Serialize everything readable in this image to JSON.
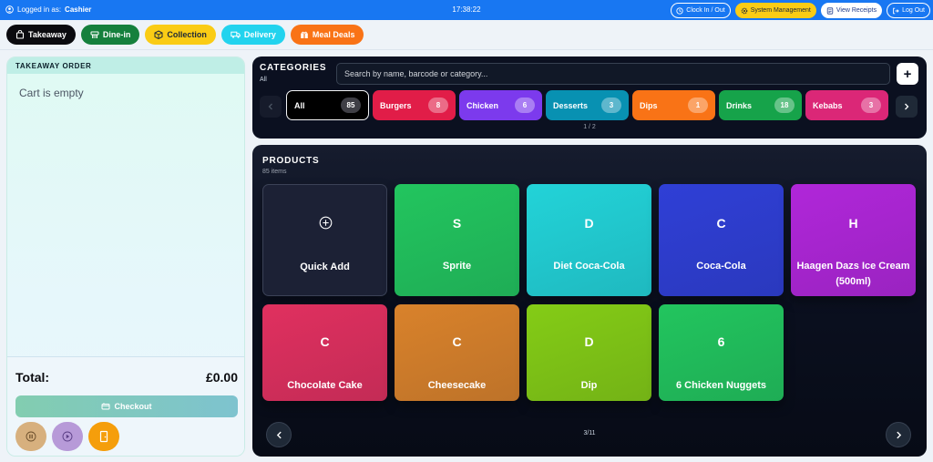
{
  "topbar": {
    "user_prefix": "Logged in as:",
    "user_name": "Cashier",
    "clock": "17:38:22",
    "clock_label": "Clock In / Out",
    "system_label": "System Management",
    "receipts_label": "View Receipts",
    "logout_label": "Log Out"
  },
  "order_types": [
    {
      "label": "Takeaway",
      "color": "#0b0b0f"
    },
    {
      "label": "Dine-in",
      "color": "#15803d"
    },
    {
      "label": "Collection",
      "color": "#facc15"
    },
    {
      "label": "Delivery",
      "color": "#22d3ee"
    },
    {
      "label": "Meal Deals",
      "color": "#f97316"
    }
  ],
  "cart": {
    "title": "TAKEAWAY ORDER",
    "empty_text": "Cart is empty",
    "total_label": "Total:",
    "total_value": "£0.00",
    "checkout_label": "Checkout"
  },
  "categories": {
    "title": "CATEGORIES",
    "subtitle": "All",
    "search_placeholder": "Search by name, barcode or category...",
    "add_label": "+",
    "page": "1 / 2",
    "items": [
      {
        "label": "All",
        "count": "85",
        "color": "#000000",
        "selected": true
      },
      {
        "label": "Burgers",
        "count": "8",
        "color": "#e11d48"
      },
      {
        "label": "Chicken",
        "count": "6",
        "color": "#7c3aed"
      },
      {
        "label": "Desserts",
        "count": "3",
        "color": "#0891b2"
      },
      {
        "label": "Dips",
        "count": "1",
        "color": "#f97316"
      },
      {
        "label": "Drinks",
        "count": "18",
        "color": "#16a34a"
      },
      {
        "label": "Kebabs",
        "count": "3",
        "color": "#db2777"
      }
    ]
  },
  "products": {
    "title": "PRODUCTS",
    "subtitle": "85 items",
    "page": "3/11",
    "quick_add_label": "Quick Add",
    "items": [
      {
        "letter": "S",
        "name": "Sprite",
        "color": "#22c55e"
      },
      {
        "letter": "D",
        "name": "Diet Coca-Cola",
        "color": "#22d3d8"
      },
      {
        "letter": "C",
        "name": "Coca-Cola",
        "color": "#2f3fd6"
      },
      {
        "letter": "H",
        "name": "Haagen Dazs Ice Cream (500ml)",
        "color": "#b026d9"
      },
      {
        "letter": "C",
        "name": "Chocolate Cake",
        "color": "#e0305f"
      },
      {
        "letter": "C",
        "name": "Cheesecake",
        "color": "#d9822b"
      },
      {
        "letter": "D",
        "name": "Dip",
        "color": "#84cc16"
      },
      {
        "letter": "6",
        "name": "6 Chicken Nuggets",
        "color": "#22c55e"
      }
    ]
  }
}
